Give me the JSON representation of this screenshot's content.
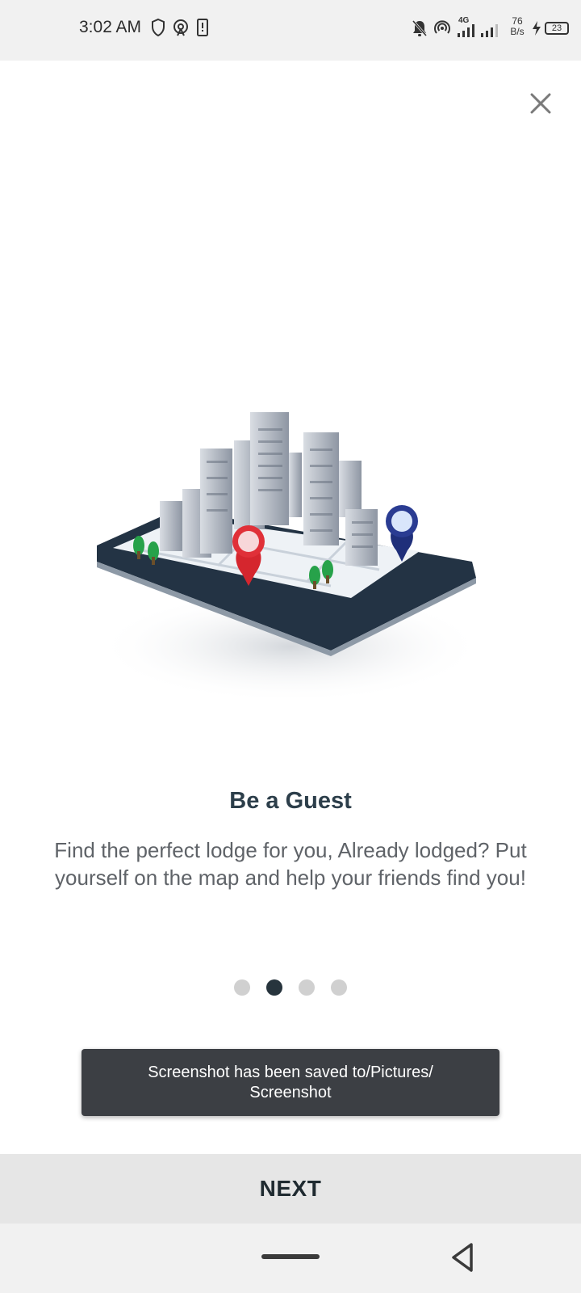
{
  "status_bar": {
    "time": "3:02 AM",
    "network_type": "4G",
    "speed_value": "76",
    "speed_unit": "B/s",
    "battery": "23",
    "icons": [
      "shield-icon",
      "hotspot-icon",
      "sim-alert-icon",
      "mute-icon",
      "wifi-hotspot-icon",
      "signal-icon",
      "signal-icon",
      "charging-icon",
      "battery-icon"
    ]
  },
  "onboarding": {
    "close_icon": "close-icon",
    "illustration": "city-map-tablet-illustration",
    "title": "Be a Guest",
    "description": "Find the perfect lodge for you, Already lodged? Put yourself on the map and help your friends find you!",
    "page_count": 4,
    "active_page": 2
  },
  "toast": {
    "message": "Screenshot has been saved to/Pictures/ Screenshot"
  },
  "footer": {
    "next_label": "NEXT"
  },
  "colors": {
    "title": "#2c3e4a",
    "dot_active": "#27343d",
    "dot_inactive": "#d0d0d0",
    "toast_bg": "#3c3f44",
    "next_bar_bg": "#e6e6e6"
  }
}
